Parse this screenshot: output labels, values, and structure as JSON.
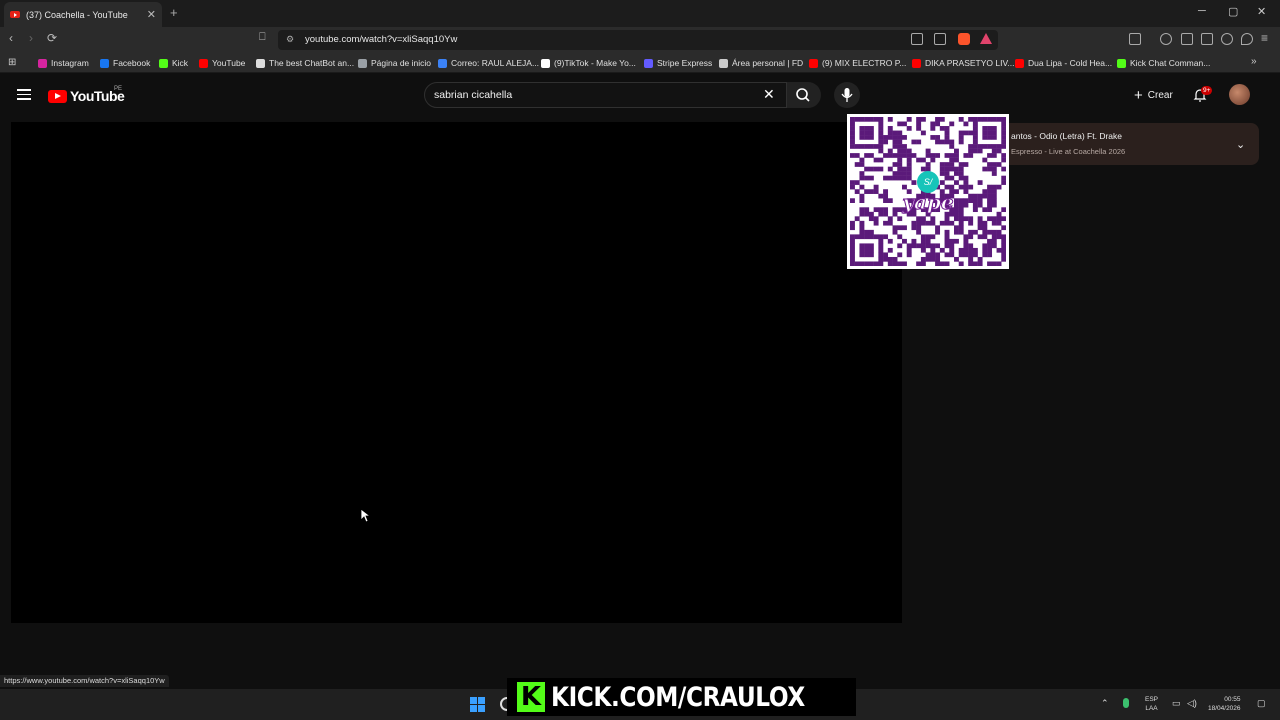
{
  "browser": {
    "tab_title": "(37) Coachella - YouTube",
    "tab_close": "✕",
    "new_tab": "+",
    "url": "youtube.com/watch?v=xliSaqq10Yw",
    "window_controls": [
      "─",
      "▢",
      "✕"
    ]
  },
  "bookmarks": [
    {
      "label": "Instagram",
      "color": "#d6249f"
    },
    {
      "label": "Facebook",
      "color": "#1877f2"
    },
    {
      "label": "Kick",
      "color": "#53fc18"
    },
    {
      "label": "YouTube",
      "color": "#ff0000"
    },
    {
      "label": "The best ChatBot an...",
      "color": "#dddddd"
    },
    {
      "label": "Página de inicio",
      "color": "#9aa0a6"
    },
    {
      "label": "Correo: RAUL ALEJA...",
      "color": "#3b82f6"
    },
    {
      "label": "(9)TikTok - Make Yo...",
      "color": "#ffffff"
    },
    {
      "label": "Stripe Express",
      "color": "#635bff"
    },
    {
      "label": "Área personal | FD",
      "color": "#cccccc"
    },
    {
      "label": "(9) MIX ELECTRO P...",
      "color": "#ff0000"
    },
    {
      "label": "DIKA PRASETYO LIV...",
      "color": "#ff0000"
    },
    {
      "label": "Dua Lipa - Cold Hea...",
      "color": "#ff0000"
    },
    {
      "label": "Kick Chat Comman...",
      "color": "#53fc18"
    }
  ],
  "youtube": {
    "logo_text": "YouTube",
    "country": "PE",
    "search_value": "sabrian cicahella",
    "clear": "✕",
    "create_label": "Crear",
    "create_plus": "+",
    "notif_badge": "9+"
  },
  "now_playing": {
    "title": "antos - Odio (Letra) Ft. Drake",
    "subtitle": "Espresso - Live at Coachella 2026",
    "chevron": "⌄"
  },
  "qr_overlay": {
    "badge": "S/",
    "brand": "yape"
  },
  "status_url": "https://www.youtube.com/watch?v=xliSaqq10Yw",
  "stream_banner": {
    "icon_letter": "K",
    "text": "KICK.COM/CRAULOX"
  },
  "taskbar": {
    "lang_line1": "ESP",
    "lang_line2": "LAA",
    "time": "00:55",
    "date": "18/04/2026"
  }
}
